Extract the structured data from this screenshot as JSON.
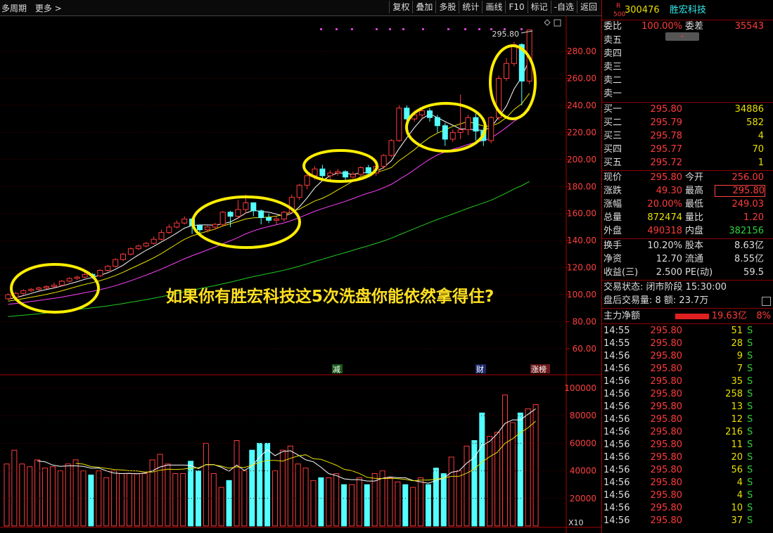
{
  "toolbar": {
    "period_label": "多周期",
    "more_label": "更多 >",
    "buttons": [
      "复权",
      "叠加",
      "多股",
      "统计",
      "画线",
      "F10",
      "标记",
      "-自选",
      "返回"
    ]
  },
  "annotation_text": "如果你有胜宏科技这5次洗盘你能依然拿得住?",
  "price_axis": [
    "280.00",
    "260.00",
    "240.00",
    "220.00",
    "200.00",
    "180.00",
    "160.00",
    "140.00",
    "120.00",
    "100.00",
    "80.00",
    "60.00"
  ],
  "volume_axis": [
    "100000",
    "80000",
    "60000",
    "40000",
    "20000"
  ],
  "volume_unit": "X10",
  "high_label": "295.80",
  "markers": {
    "jian": "减",
    "cai": "财",
    "zhangbang": "涨榜"
  },
  "chart_data": {
    "type": "candlestick",
    "ylim": [
      50,
      300
    ],
    "candles": [
      [
        97,
        100,
        96,
        101
      ],
      [
        98,
        101,
        97,
        102
      ],
      [
        101,
        103,
        100,
        104
      ],
      [
        103,
        104,
        102,
        105
      ],
      [
        104,
        105,
        103,
        106
      ],
      [
        105,
        106,
        104,
        107
      ],
      [
        106,
        107,
        105,
        109
      ],
      [
        107,
        110,
        106,
        111
      ],
      [
        110,
        112,
        109,
        113
      ],
      [
        112,
        113,
        111,
        114
      ],
      [
        113,
        115,
        112,
        117
      ],
      [
        115,
        114,
        112,
        116
      ],
      [
        114,
        118,
        113,
        119
      ],
      [
        118,
        121,
        117,
        122
      ],
      [
        121,
        126,
        120,
        127
      ],
      [
        126,
        130,
        125,
        131
      ],
      [
        130,
        134,
        129,
        135
      ],
      [
        134,
        136,
        133,
        137
      ],
      [
        136,
        138,
        135,
        139
      ],
      [
        138,
        141,
        137,
        143
      ],
      [
        141,
        146,
        140,
        148
      ],
      [
        146,
        150,
        145,
        152
      ],
      [
        150,
        153,
        149,
        155
      ],
      [
        153,
        156,
        152,
        158
      ],
      [
        156,
        151,
        145,
        157
      ],
      [
        151,
        148,
        144,
        152
      ],
      [
        148,
        150,
        146,
        151
      ],
      [
        150,
        152,
        148,
        153
      ],
      [
        152,
        161,
        151,
        162
      ],
      [
        161,
        158,
        150,
        162
      ],
      [
        158,
        163,
        156,
        170
      ],
      [
        163,
        168,
        160,
        174
      ],
      [
        168,
        162,
        158,
        168
      ],
      [
        162,
        157,
        152,
        163
      ],
      [
        157,
        155,
        153,
        160
      ],
      [
        155,
        156,
        152,
        158
      ],
      [
        156,
        161,
        154,
        162
      ],
      [
        161,
        172,
        160,
        174
      ],
      [
        172,
        181,
        170,
        182
      ],
      [
        181,
        188,
        178,
        189
      ],
      [
        188,
        193,
        185,
        195
      ],
      [
        193,
        188,
        186,
        196
      ],
      [
        188,
        190,
        185,
        192
      ],
      [
        190,
        191,
        188,
        193
      ],
      [
        191,
        187,
        185,
        192
      ],
      [
        187,
        189,
        186,
        191
      ],
      [
        189,
        194,
        187,
        195
      ],
      [
        194,
        190,
        188,
        196
      ],
      [
        190,
        195,
        188,
        198
      ],
      [
        195,
        203,
        193,
        204
      ],
      [
        203,
        214,
        202,
        215
      ],
      [
        214,
        238,
        213,
        240
      ],
      [
        238,
        230,
        225,
        240
      ],
      [
        230,
        233,
        228,
        236
      ],
      [
        233,
        236,
        230,
        238
      ],
      [
        236,
        231,
        228,
        238
      ],
      [
        231,
        225,
        220,
        233
      ],
      [
        225,
        215,
        210,
        227
      ],
      [
        215,
        220,
        213,
        222
      ],
      [
        220,
        222,
        215,
        248
      ],
      [
        222,
        231,
        218,
        233
      ],
      [
        231,
        221,
        214,
        234
      ],
      [
        221,
        214,
        210,
        224
      ],
      [
        214,
        231,
        212,
        232
      ],
      [
        231,
        260,
        229,
        262
      ],
      [
        260,
        271,
        258,
        275
      ],
      [
        271,
        285,
        269,
        287
      ],
      [
        285,
        258,
        240,
        286
      ],
      [
        258,
        295.8,
        256,
        296
      ]
    ],
    "volume": [
      45,
      55,
      45,
      43,
      48,
      42,
      43,
      40,
      45,
      48,
      40,
      37,
      40,
      35,
      40,
      38,
      38,
      38,
      38,
      48,
      52,
      45,
      38,
      38,
      47,
      40,
      60,
      38,
      28,
      33,
      62,
      40,
      55,
      60,
      60,
      40,
      55,
      58,
      45,
      42,
      33,
      35,
      35,
      38,
      30,
      30,
      35,
      30,
      38,
      40,
      35,
      32,
      30,
      28,
      35,
      30,
      42,
      38,
      50,
      40,
      58,
      62,
      82,
      65,
      68,
      95,
      75,
      82,
      85,
      88
    ]
  },
  "panel": {
    "code": "300476",
    "name": "胜宏科技",
    "badge_r": "R",
    "badge_500": "500",
    "weibi_label": "委比",
    "weibi": "100.00%",
    "weicha_label": "委差",
    "weicha": "35543",
    "sell_labels": [
      "卖五",
      "卖四",
      "卖三",
      "卖二",
      "卖一"
    ],
    "buys": [
      {
        "label": "买一",
        "price": "295.80",
        "vol": "34886"
      },
      {
        "label": "买二",
        "price": "295.79",
        "vol": "582"
      },
      {
        "label": "买三",
        "price": "295.78",
        "vol": "4"
      },
      {
        "label": "买四",
        "price": "295.77",
        "vol": "70"
      },
      {
        "label": "买五",
        "price": "295.72",
        "vol": "1"
      }
    ],
    "stats": [
      [
        "现价",
        "295.80",
        "今开",
        "256.00"
      ],
      [
        "涨跌",
        "49.30",
        "最高",
        "295.80"
      ],
      [
        "涨幅",
        "20.00%",
        "最低",
        "249.03"
      ],
      [
        "总量",
        "872474",
        "量比",
        "1.20"
      ],
      [
        "外盘",
        "490318",
        "内盘",
        "382156"
      ]
    ],
    "stats2": [
      [
        "换手",
        "10.20%",
        "股本",
        "8.63亿"
      ],
      [
        "净资",
        "12.70",
        "流通",
        "8.55亿"
      ],
      [
        "收益(三)",
        "2.500",
        "PE(动)",
        "59.5"
      ]
    ],
    "trade_status": "交易状态: 闭市阶段  15:30:00",
    "after_hours": "盘后交易量: 8  额: 23.7万",
    "main_net_label": "主力净额",
    "main_net_value": "19.63亿",
    "main_net_pct": "8%",
    "ticks": [
      [
        "14:55",
        "295.80",
        "51",
        "S"
      ],
      [
        "14:55",
        "295.80",
        "28",
        "S"
      ],
      [
        "14:56",
        "295.80",
        "9",
        "S"
      ],
      [
        "14:56",
        "295.80",
        "7",
        "S"
      ],
      [
        "14:56",
        "295.80",
        "35",
        "S"
      ],
      [
        "14:56",
        "295.80",
        "258",
        "S"
      ],
      [
        "14:56",
        "295.80",
        "13",
        "S"
      ],
      [
        "14:56",
        "295.80",
        "12",
        "S"
      ],
      [
        "14:56",
        "295.80",
        "216",
        "S"
      ],
      [
        "14:56",
        "295.80",
        "11",
        "S"
      ],
      [
        "14:56",
        "295.80",
        "20",
        "S"
      ],
      [
        "14:56",
        "295.80",
        "56",
        "S"
      ],
      [
        "14:56",
        "295.80",
        "4",
        "S"
      ],
      [
        "14:56",
        "295.80",
        "4",
        "S"
      ],
      [
        "14:56",
        "295.80",
        "10",
        "S"
      ],
      [
        "14:56",
        "295.80",
        "37",
        "S"
      ]
    ]
  }
}
